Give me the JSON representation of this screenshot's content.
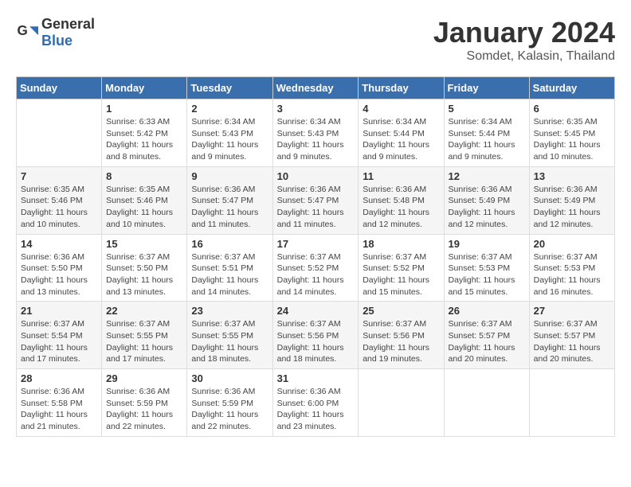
{
  "header": {
    "logo_general": "General",
    "logo_blue": "Blue",
    "month_title": "January 2024",
    "location": "Somdet, Kalasin, Thailand"
  },
  "days_of_week": [
    "Sunday",
    "Monday",
    "Tuesday",
    "Wednesday",
    "Thursday",
    "Friday",
    "Saturday"
  ],
  "weeks": [
    [
      {
        "day": "",
        "info": ""
      },
      {
        "day": "1",
        "info": "Sunrise: 6:33 AM\nSunset: 5:42 PM\nDaylight: 11 hours\nand 8 minutes."
      },
      {
        "day": "2",
        "info": "Sunrise: 6:34 AM\nSunset: 5:43 PM\nDaylight: 11 hours\nand 9 minutes."
      },
      {
        "day": "3",
        "info": "Sunrise: 6:34 AM\nSunset: 5:43 PM\nDaylight: 11 hours\nand 9 minutes."
      },
      {
        "day": "4",
        "info": "Sunrise: 6:34 AM\nSunset: 5:44 PM\nDaylight: 11 hours\nand 9 minutes."
      },
      {
        "day": "5",
        "info": "Sunrise: 6:34 AM\nSunset: 5:44 PM\nDaylight: 11 hours\nand 9 minutes."
      },
      {
        "day": "6",
        "info": "Sunrise: 6:35 AM\nSunset: 5:45 PM\nDaylight: 11 hours\nand 10 minutes."
      }
    ],
    [
      {
        "day": "7",
        "info": "Sunrise: 6:35 AM\nSunset: 5:46 PM\nDaylight: 11 hours\nand 10 minutes."
      },
      {
        "day": "8",
        "info": "Sunrise: 6:35 AM\nSunset: 5:46 PM\nDaylight: 11 hours\nand 10 minutes."
      },
      {
        "day": "9",
        "info": "Sunrise: 6:36 AM\nSunset: 5:47 PM\nDaylight: 11 hours\nand 11 minutes."
      },
      {
        "day": "10",
        "info": "Sunrise: 6:36 AM\nSunset: 5:47 PM\nDaylight: 11 hours\nand 11 minutes."
      },
      {
        "day": "11",
        "info": "Sunrise: 6:36 AM\nSunset: 5:48 PM\nDaylight: 11 hours\nand 12 minutes."
      },
      {
        "day": "12",
        "info": "Sunrise: 6:36 AM\nSunset: 5:49 PM\nDaylight: 11 hours\nand 12 minutes."
      },
      {
        "day": "13",
        "info": "Sunrise: 6:36 AM\nSunset: 5:49 PM\nDaylight: 11 hours\nand 12 minutes."
      }
    ],
    [
      {
        "day": "14",
        "info": "Sunrise: 6:36 AM\nSunset: 5:50 PM\nDaylight: 11 hours\nand 13 minutes."
      },
      {
        "day": "15",
        "info": "Sunrise: 6:37 AM\nSunset: 5:50 PM\nDaylight: 11 hours\nand 13 minutes."
      },
      {
        "day": "16",
        "info": "Sunrise: 6:37 AM\nSunset: 5:51 PM\nDaylight: 11 hours\nand 14 minutes."
      },
      {
        "day": "17",
        "info": "Sunrise: 6:37 AM\nSunset: 5:52 PM\nDaylight: 11 hours\nand 14 minutes."
      },
      {
        "day": "18",
        "info": "Sunrise: 6:37 AM\nSunset: 5:52 PM\nDaylight: 11 hours\nand 15 minutes."
      },
      {
        "day": "19",
        "info": "Sunrise: 6:37 AM\nSunset: 5:53 PM\nDaylight: 11 hours\nand 15 minutes."
      },
      {
        "day": "20",
        "info": "Sunrise: 6:37 AM\nSunset: 5:53 PM\nDaylight: 11 hours\nand 16 minutes."
      }
    ],
    [
      {
        "day": "21",
        "info": "Sunrise: 6:37 AM\nSunset: 5:54 PM\nDaylight: 11 hours\nand 17 minutes."
      },
      {
        "day": "22",
        "info": "Sunrise: 6:37 AM\nSunset: 5:55 PM\nDaylight: 11 hours\nand 17 minutes."
      },
      {
        "day": "23",
        "info": "Sunrise: 6:37 AM\nSunset: 5:55 PM\nDaylight: 11 hours\nand 18 minutes."
      },
      {
        "day": "24",
        "info": "Sunrise: 6:37 AM\nSunset: 5:56 PM\nDaylight: 11 hours\nand 18 minutes."
      },
      {
        "day": "25",
        "info": "Sunrise: 6:37 AM\nSunset: 5:56 PM\nDaylight: 11 hours\nand 19 minutes."
      },
      {
        "day": "26",
        "info": "Sunrise: 6:37 AM\nSunset: 5:57 PM\nDaylight: 11 hours\nand 20 minutes."
      },
      {
        "day": "27",
        "info": "Sunrise: 6:37 AM\nSunset: 5:57 PM\nDaylight: 11 hours\nand 20 minutes."
      }
    ],
    [
      {
        "day": "28",
        "info": "Sunrise: 6:36 AM\nSunset: 5:58 PM\nDaylight: 11 hours\nand 21 minutes."
      },
      {
        "day": "29",
        "info": "Sunrise: 6:36 AM\nSunset: 5:59 PM\nDaylight: 11 hours\nand 22 minutes."
      },
      {
        "day": "30",
        "info": "Sunrise: 6:36 AM\nSunset: 5:59 PM\nDaylight: 11 hours\nand 22 minutes."
      },
      {
        "day": "31",
        "info": "Sunrise: 6:36 AM\nSunset: 6:00 PM\nDaylight: 11 hours\nand 23 minutes."
      },
      {
        "day": "",
        "info": ""
      },
      {
        "day": "",
        "info": ""
      },
      {
        "day": "",
        "info": ""
      }
    ]
  ]
}
